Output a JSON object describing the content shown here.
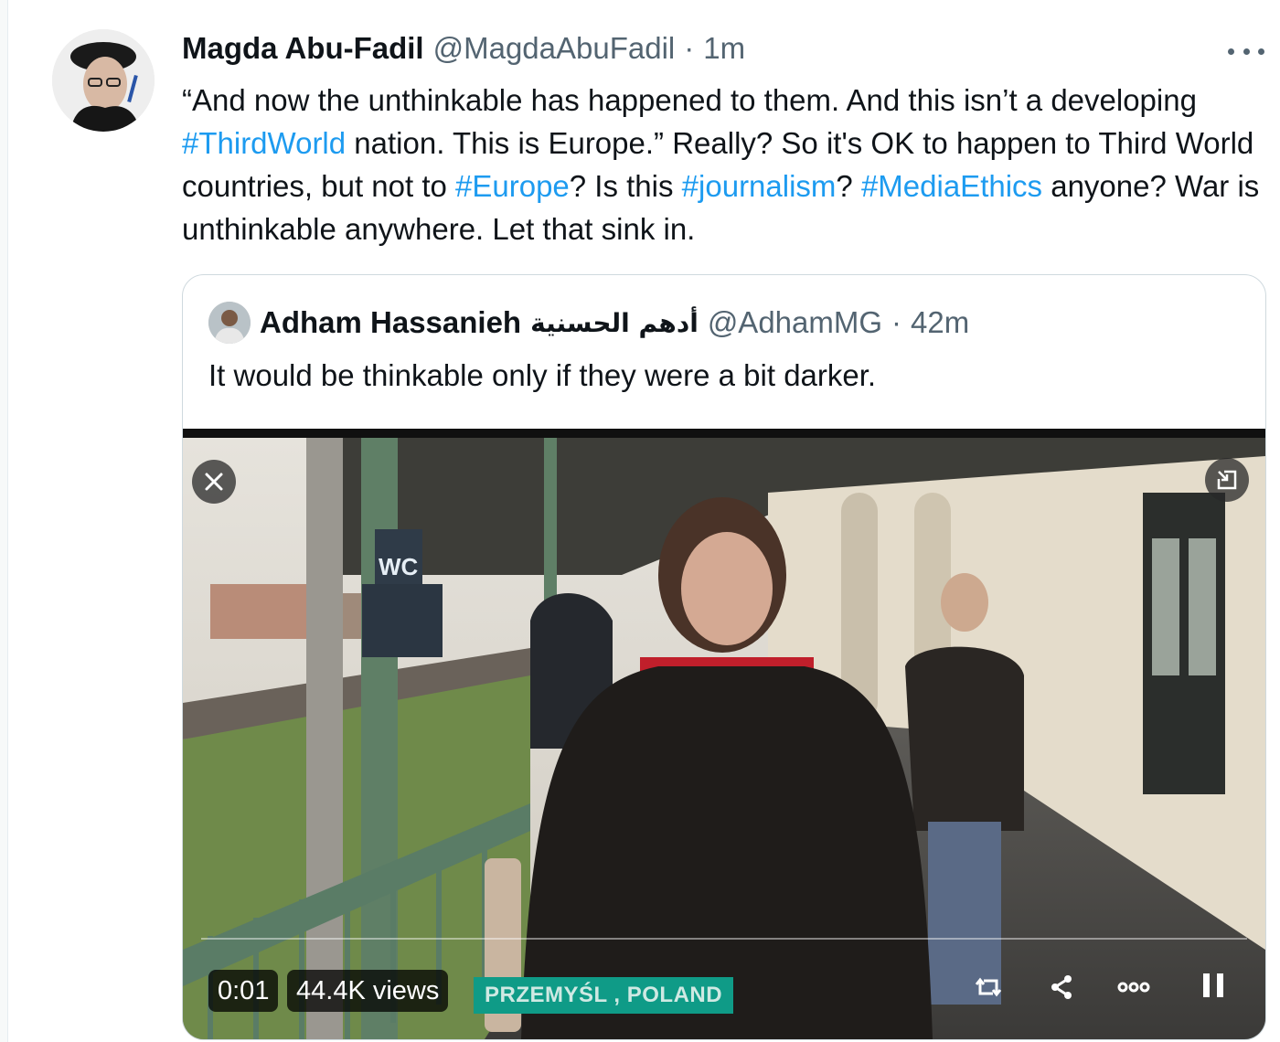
{
  "tweet": {
    "author_name": "Magda Abu-Fadil",
    "author_handle": "@MagdaAbuFadil",
    "separator": "·",
    "timestamp": "1m",
    "text_parts": {
      "p1": "“And now the unthinkable has happened to them. And this isn’t a developing ",
      "tag1": "#ThirdWorld",
      "p2": " nation. This is Europe.” Really? So it's OK to happen to Third World countries, but not to ",
      "tag2": "#Europe",
      "p3": "? Is this ",
      "tag3": "#journalism",
      "p4": "? ",
      "tag4": "#MediaEthics",
      "p5": " anyone? War is unthinkable anywhere. Let that sink in."
    }
  },
  "quoted_tweet": {
    "author_name": "Adham Hassanieh",
    "author_name_arabic": "أدهم الحسنية",
    "author_handle": "@AdhamMG",
    "separator": "·",
    "timestamp": "42m",
    "text": "It would be thinkable only if they were a bit darker."
  },
  "video": {
    "elapsed": "0:01",
    "views": "44.4K views",
    "location_caption": "PRZEMYŚL , POLAND",
    "sign_text": "WC"
  },
  "colors": {
    "link": "#1d9bf0",
    "secondary_text": "#536471",
    "border": "#cfd9de",
    "caption_bg": "#0f9b87"
  }
}
